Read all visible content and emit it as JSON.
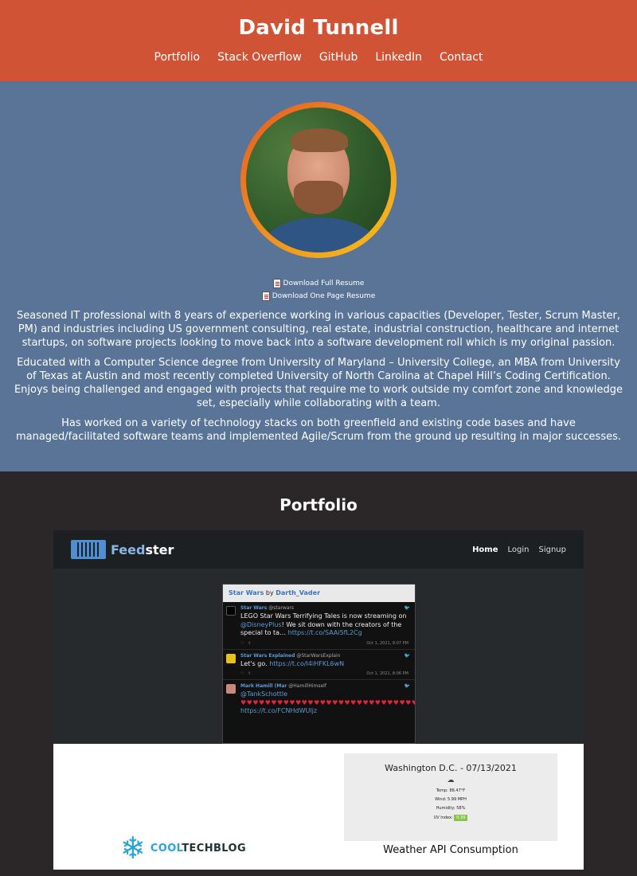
{
  "header": {
    "title": "David Tunnell",
    "nav": [
      "Portfolio",
      "Stack Overflow",
      "GitHub",
      "LinkedIn",
      "Contact"
    ]
  },
  "about": {
    "downloads": [
      "Download Full Resume",
      "Download One Page Resume"
    ],
    "bio": [
      "Seasoned IT professional with 8 years of experience working in various capacities (Developer, Tester, Scrum Master, PM) and industries including US government consulting, real estate, industrial construction, healthcare and internet startups, on software projects looking to move back into a software development roll which is my original passion.",
      "Educated with a Computer Science degree from University of Maryland – University College, an MBA from University of Texas at Austin and most recently completed University of North Carolina at Chapel Hill’s Coding Certification. Enjoys being challenged and engaged with projects that require me to work outside my comfort zone and knowledge set, especially while collaborating with a team.",
      "Has worked on a variety of technology stacks on both greenfield and existing code bases and have managed/facilitated software teams and implemented Agile/Scrum from the ground up resulting in major successes."
    ]
  },
  "portfolio": {
    "title": "Portfolio",
    "feedster": {
      "brand_a": "Feed",
      "brand_b": "ster",
      "nav": [
        "Home",
        "Login",
        "Signup"
      ],
      "card_title_a": "Star Wars",
      "card_title_by": " by ",
      "card_title_b": "Darth_Vader",
      "tweets": [
        {
          "name": "Star Wars",
          "handle": "@starwars",
          "text": "LEGO Star Wars Terrifying Tales is now streaming on ",
          "mention": "@DisneyPlus",
          "text2": "! We sit down with the creators of the special to ta… ",
          "link": "https://t.co/SAAi5fL2Cg",
          "date": "Oct 1, 2021, 8:07 PM"
        },
        {
          "name": "Star Wars Explained",
          "handle": "@StarWarsExplain",
          "text": "Let's go. ",
          "link": "https://t.co/I4iHFKL6wN",
          "date": "Oct 1, 2021, 8:06 PM"
        },
        {
          "name": "Mark Hamill (Mar",
          "handle": "@HamillHimself",
          "mention": "@TankSchottle",
          "link": "https://t.co/FCNHdWUljz"
        }
      ]
    },
    "weather": {
      "title": "Washington D.C. - 07/13/2021",
      "temp": "Temp: 88.47°F",
      "wind": "Wind: 5.99 MPH",
      "humidity": "Humidity: 58%",
      "uv_label": "UV Index:",
      "uv_value": "0.39",
      "caption": "Weather API Consumption"
    },
    "cooltechblog": {
      "part_a": "COOL",
      "part_b": "TECHBLOG"
    }
  }
}
